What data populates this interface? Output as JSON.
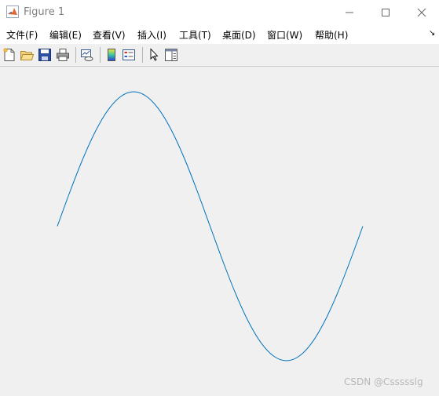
{
  "window": {
    "title": "Figure 1"
  },
  "menu": [
    {
      "label": "文件(F)"
    },
    {
      "label": "编辑(E)"
    },
    {
      "label": "查看(V)"
    },
    {
      "label": "插入(I)"
    },
    {
      "label": "工具(T)"
    },
    {
      "label": "桌面(D)"
    },
    {
      "label": "窗口(W)"
    },
    {
      "label": "帮助(H)"
    }
  ],
  "toolbar": {
    "icons": [
      "new-figure-icon",
      "open-file-icon",
      "save-icon",
      "print-icon",
      "link-plot-icon",
      "insert-colorbar-icon",
      "insert-legend-icon",
      "edit-plot-pointer-icon",
      "property-inspector-icon"
    ]
  },
  "chart_data": {
    "type": "line",
    "function": "sin(x)",
    "x": [
      0,
      0.2618,
      0.5236,
      0.7854,
      1.0472,
      1.309,
      1.5708,
      1.8326,
      2.0944,
      2.3562,
      2.618,
      2.8798,
      3.1416,
      3.4034,
      3.6652,
      3.927,
      4.1888,
      4.4506,
      4.7124,
      4.9742,
      5.236,
      5.4978,
      5.7596,
      6.0214,
      6.2832
    ],
    "series": [
      {
        "values": [
          0,
          0.2588,
          0.5,
          0.7071,
          0.866,
          0.9659,
          1,
          0.9659,
          0.866,
          0.7071,
          0.5,
          0.2588,
          0,
          -0.2588,
          -0.5,
          -0.7071,
          -0.866,
          -0.9659,
          -1,
          -0.9659,
          -0.866,
          -0.7071,
          -0.5,
          -0.2588,
          0
        ]
      }
    ],
    "xlim": [
      0,
      6.2832
    ],
    "ylim": [
      -1,
      1
    ],
    "axes_visible": false,
    "grid": false,
    "line_color": "#0072bd"
  },
  "watermark": "CSDN @Cssssslg"
}
